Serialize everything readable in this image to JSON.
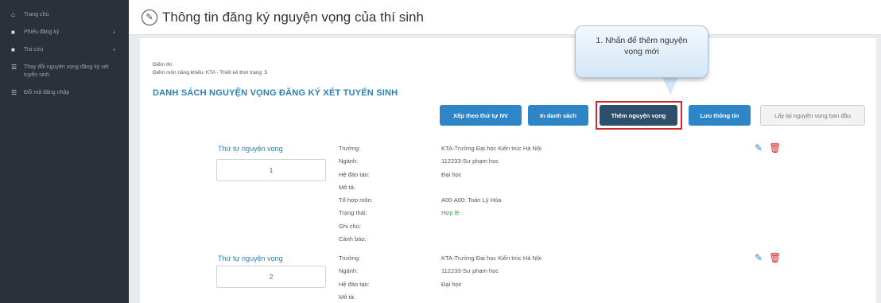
{
  "sidebar": {
    "items": [
      {
        "icon": "home-icon",
        "label": "Trang chủ",
        "plus": ""
      },
      {
        "icon": "folder-icon",
        "label": "Phiếu đăng ký",
        "plus": "+"
      },
      {
        "icon": "folder-icon",
        "label": "Tra cứu",
        "plus": "+"
      },
      {
        "icon": "list-icon",
        "label": "Thay đổi nguyện vọng đăng ký xét tuyển sinh",
        "plus": ""
      },
      {
        "icon": "list-icon",
        "label": "Đổi mã đăng nhập",
        "plus": ""
      }
    ]
  },
  "header": {
    "title": "Thông tin đăng ký nguyện vọng của thí sinh"
  },
  "meta": {
    "line1": "Điểm thi:",
    "line2": "Điểm môn năng khiếu: KTA - Thiết kế thời trang: 5"
  },
  "list_title": "DANH SÁCH NGUYỆN VỌNG ĐĂNG KÝ XÉT TUYỂN SINH",
  "buttons": {
    "sort": "Xếp theo thứ tự NV",
    "print": "In danh sách",
    "add": "Thêm nguyện vọng",
    "save": "Lưu thông tin",
    "restore": "Lấy lại nguyện vọng ban đầu"
  },
  "callout": "1. Nhấn để thêm nguyện vọng mới",
  "colors": {
    "accent": "#2e86c9",
    "dark_button": "#2c4f6c",
    "highlight": "#d12828",
    "sidebar": "#2b3138"
  },
  "records": [
    {
      "order_label": "Thứ tự nguyện vọng",
      "order_value": "1",
      "labels": [
        "Trường:",
        "Ngành:",
        "Hệ đào tạo:",
        "Mô tả:",
        "Tổ hợp môn:",
        "Trạng thái:",
        "Ghi chú:",
        "Cảnh báo:"
      ],
      "values": [
        "KTA-Trường Đại học Kiến trúc Hà Nội",
        "112233-Sư phạm học",
        "Đại học",
        "",
        "A00-A00: Toán Lý Hóa",
        "Hợp lệ",
        "",
        ""
      ]
    },
    {
      "order_label": "Thứ tự nguyện vọng",
      "order_value": "2",
      "labels": [
        "Trường:",
        "Ngành:",
        "Hệ đào tạo:",
        "Mô tả:"
      ],
      "values": [
        "KTA-Trường Đại học Kiến trúc Hà Nội",
        "112233-Sư phạm học",
        "Đại học",
        ""
      ]
    }
  ]
}
